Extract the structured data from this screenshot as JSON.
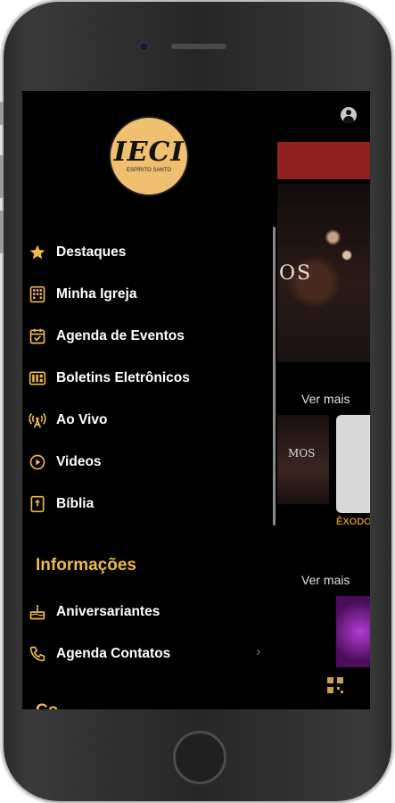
{
  "logo": {
    "main": "IECI",
    "sub": "ESPÍRITO SANTO"
  },
  "menu": [
    {
      "label": "Destaques",
      "icon": "star-icon"
    },
    {
      "label": "Minha Igreja",
      "icon": "building-icon"
    },
    {
      "label": "Agenda de Eventos",
      "icon": "calendar-check-icon"
    },
    {
      "label": "Boletins Eletrônicos",
      "icon": "newspaper-icon"
    },
    {
      "label": "Ao Vivo",
      "icon": "broadcast-icon"
    },
    {
      "label": "Videos",
      "icon": "play-circle-icon"
    },
    {
      "label": "Bíblia",
      "icon": "bible-icon"
    }
  ],
  "section": {
    "title": "Informações"
  },
  "info_menu": [
    {
      "label": "Aniversariantes",
      "icon": "cake-icon"
    },
    {
      "label": "Agenda Contatos",
      "icon": "phone-icon"
    }
  ],
  "next_section": {
    "title": "Co..."
  },
  "content": {
    "ver_mais_1": "Ver mais",
    "ver_mais_2": "Ver mais",
    "card_text_1": "OS",
    "card_text_2": "MOS",
    "card_label": "ÊXODO"
  },
  "colors": {
    "accent": "#f0b946",
    "banner": "#8e2020",
    "background": "#000000"
  }
}
